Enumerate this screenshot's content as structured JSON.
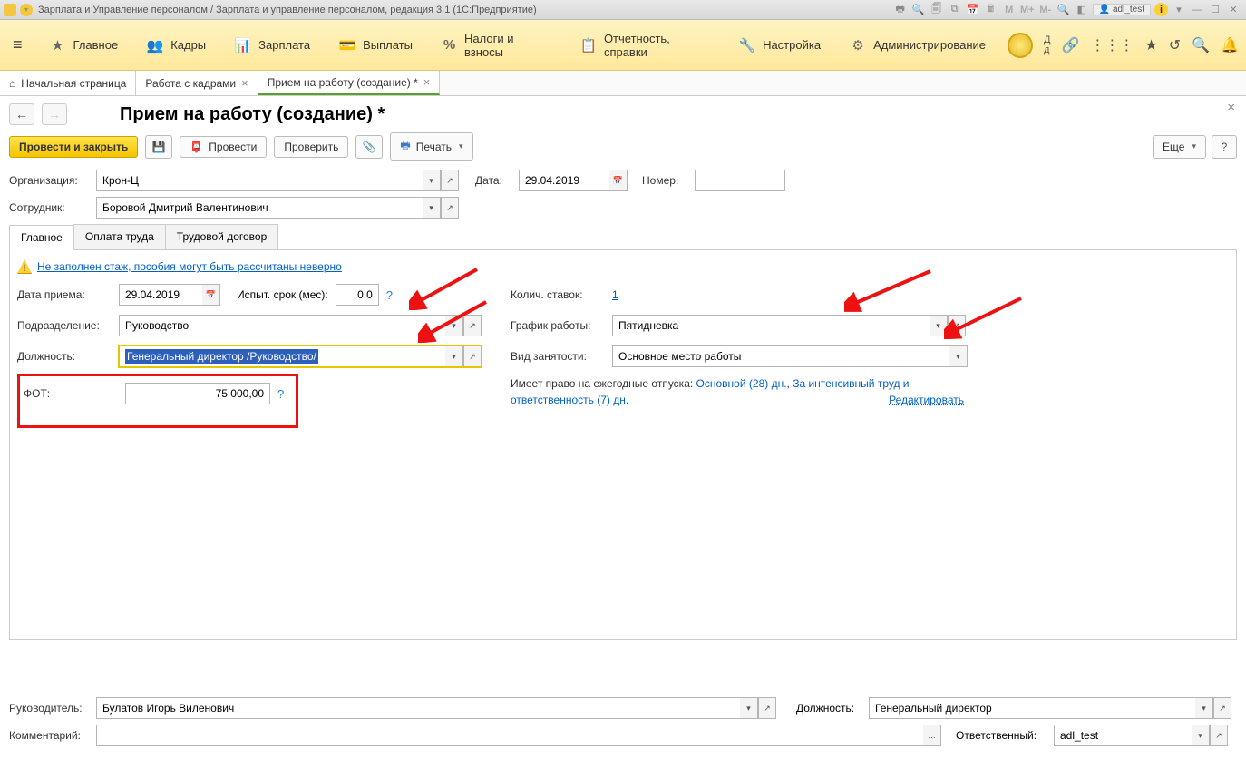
{
  "titlebar": {
    "title": "Зарплата и Управление персоналом / Зарплата и управление персоналом, редакция 3.1 (1С:Предприятие)",
    "user": "adl_test"
  },
  "mainnav": {
    "items": [
      {
        "icon": "★",
        "label": "Главное"
      },
      {
        "icon": "👥",
        "label": "Кадры"
      },
      {
        "icon": "📊",
        "label": "Зарплата"
      },
      {
        "icon": "💳",
        "label": "Выплаты"
      },
      {
        "icon": "%",
        "label": "Налоги и взносы"
      },
      {
        "icon": "📋",
        "label": "Отчетность, справки"
      },
      {
        "icon": "🔧",
        "label": "Настройка"
      },
      {
        "icon": "⚙",
        "label": "Администрирование"
      }
    ],
    "extra": "Д\\nд"
  },
  "tabs": {
    "home": "Начальная страница",
    "t1": "Работа с кадрами",
    "t2": "Прием на работу (создание) *"
  },
  "doc": {
    "title": "Прием на работу (создание) *"
  },
  "toolbar": {
    "post_close": "Провести и закрыть",
    "post": "Провести",
    "check": "Проверить",
    "print": "Печать",
    "more": "Еще"
  },
  "head_fields": {
    "org_label": "Организация:",
    "org_value": "Крон-Ц",
    "date_label": "Дата:",
    "date_value": "29.04.2019",
    "number_label": "Номер:",
    "number_value": "",
    "emp_label": "Сотрудник:",
    "emp_value": "Боровой Дмитрий Валентинович"
  },
  "inner_tabs": {
    "t1": "Главное",
    "t2": "Оплата труда",
    "t3": "Трудовой договор"
  },
  "warning_text": "Не заполнен стаж, пособия могут быть рассчитаны неверно",
  "left": {
    "hire_date_label": "Дата приема:",
    "hire_date_value": "29.04.2019",
    "probation_label": "Испыт. срок (мес):",
    "probation_value": "0,0",
    "dept_label": "Подразделение:",
    "dept_value": "Руководство",
    "position_label": "Должность:",
    "position_value": "Генеральный директор /Руководство/",
    "fot_label": "ФОТ:",
    "fot_value": "75 000,00"
  },
  "right": {
    "rates_label": "Колич. ставок:",
    "rates_value": "1",
    "schedule_label": "График работы:",
    "schedule_value": "Пятидневка",
    "emptype_label": "Вид занятости:",
    "emptype_value": "Основное место работы",
    "vacation_prefix": "Имеет право на ежегодные отпуска: ",
    "vacation_main": "Основной (28) дн.",
    "vacation_sep": ", ",
    "vacation_extra": "За интенсивный труд и ответственность (7) дн.",
    "edit": "Редактировать"
  },
  "footer": {
    "manager_label": "Руководитель:",
    "manager_value": "Булатов Игорь Виленович",
    "manager_pos_label": "Должность:",
    "manager_pos_value": "Генеральный директор",
    "comment_label": "Комментарий:",
    "comment_value": "",
    "responsible_label": "Ответственный:",
    "responsible_value": "adl_test"
  }
}
